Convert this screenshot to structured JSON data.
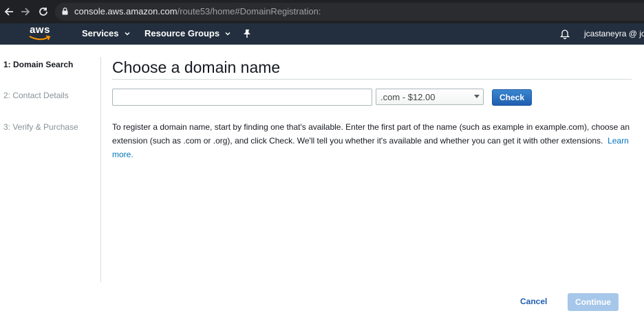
{
  "browser": {
    "url_host": "console.aws.amazon.com",
    "url_path": "/route53/home#DomainRegistration:"
  },
  "aws_nav": {
    "logo_text": "aws",
    "services_label": "Services",
    "resource_groups_label": "Resource Groups",
    "user_label": "jcastaneyra @ jca"
  },
  "steps": [
    {
      "label": "1: Domain Search",
      "active": true
    },
    {
      "label": "2: Contact Details",
      "active": false
    },
    {
      "label": "3: Verify & Purchase",
      "active": false
    }
  ],
  "main": {
    "title": "Choose a domain name",
    "domain_input": {
      "value": "",
      "placeholder": ""
    },
    "tld_select": {
      "selected": ".com - $12.00"
    },
    "check_label": "Check",
    "description": "To register a domain name, start by finding one that's available. Enter the first part of the name (such as example in example.com), choose an extension (such as .com or .org), and click Check. We'll tell you whether it's available and whether you can get it with other extensions.",
    "learn_more": "Learn more."
  },
  "footer": {
    "cancel_label": "Cancel",
    "continue_label": "Continue"
  },
  "colors": {
    "aws_nav_bg": "#232f3e",
    "primary_button": "#1f5fb0",
    "disabled_button": "#a6c7ea",
    "link": "#0073bb"
  }
}
